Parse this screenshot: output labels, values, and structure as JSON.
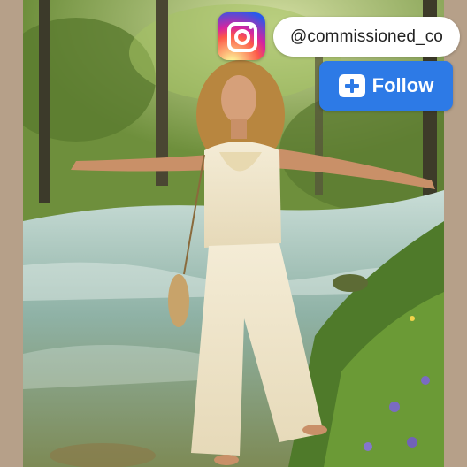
{
  "post": {
    "instagram_handle": "@commissioned_co",
    "follow_label": "Follow",
    "logo_icon": "instagram-logo-icon",
    "follow_icon": "plus-icon",
    "photo_subject": "photo",
    "colors": {
      "follow_blue": "#2d7ae6",
      "border_tan": "#b6a089"
    }
  }
}
